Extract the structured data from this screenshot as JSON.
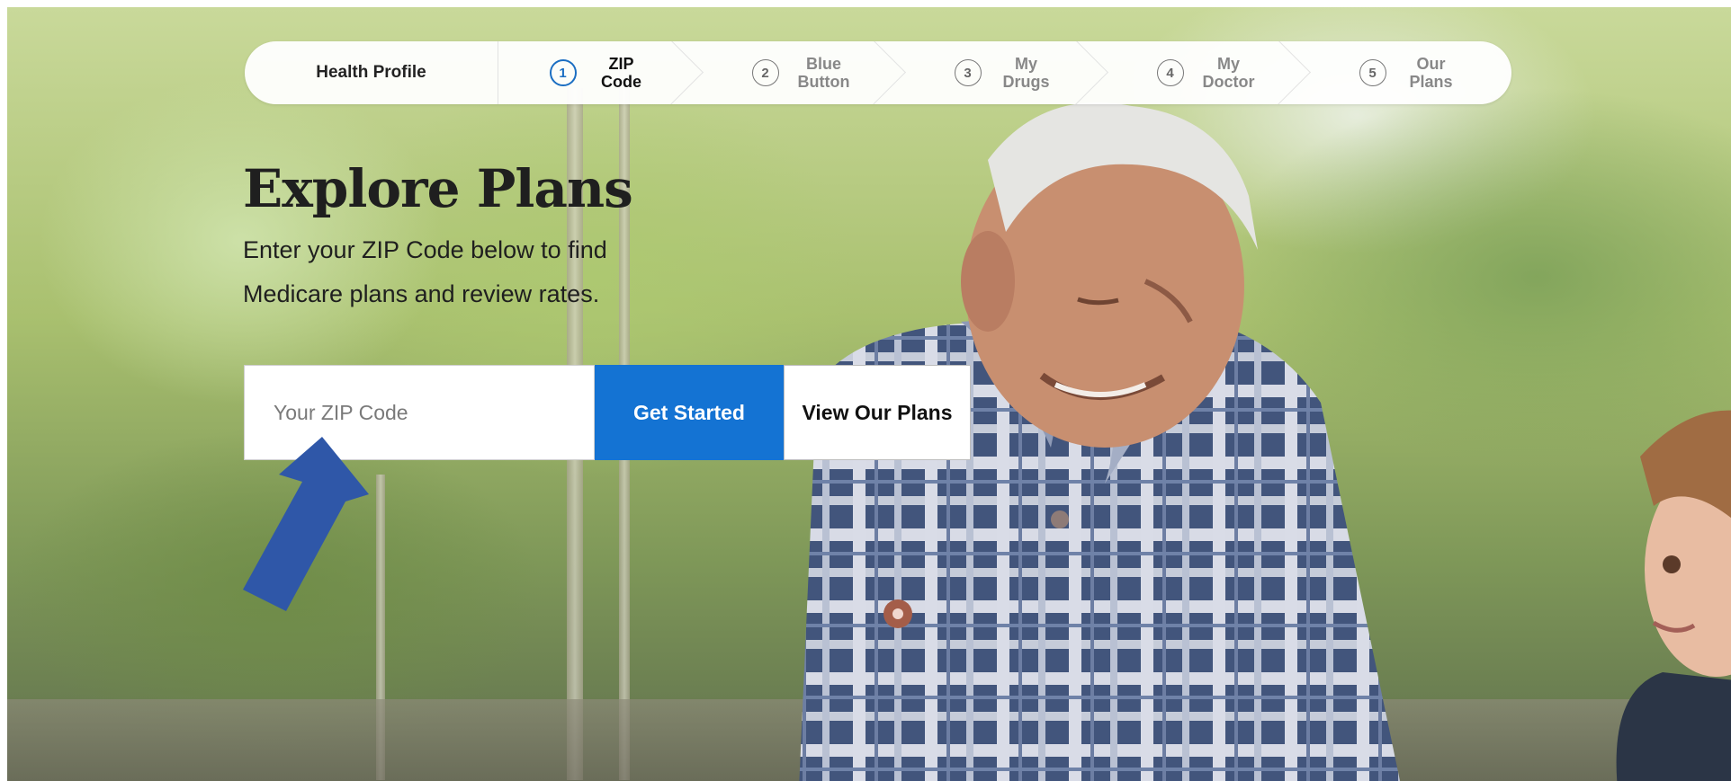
{
  "stepper": {
    "title": "Health Profile",
    "steps": [
      {
        "number": "1",
        "line1": "ZIP",
        "line2": "Code"
      },
      {
        "number": "2",
        "line1": "Blue",
        "line2": "Button"
      },
      {
        "number": "3",
        "line1": "My",
        "line2": "Drugs"
      },
      {
        "number": "4",
        "line1": "My",
        "line2": "Doctor"
      },
      {
        "number": "5",
        "line1": "Our",
        "line2": "Plans"
      }
    ]
  },
  "hero": {
    "title": "Explore Plans",
    "subtitle_line1": "Enter your ZIP Code below to find",
    "subtitle_line2": "Medicare plans and review rates."
  },
  "form": {
    "zip_placeholder": "Your ZIP Code",
    "zip_value": "",
    "get_started_label": "Get Started",
    "view_plans_label": "View Our Plans"
  },
  "colors": {
    "accent": "#1473d3",
    "arrow": "#2f57a8",
    "active_step": "#1b6ec2"
  },
  "icons": {
    "annotation": "arrow-up-right-icon"
  }
}
